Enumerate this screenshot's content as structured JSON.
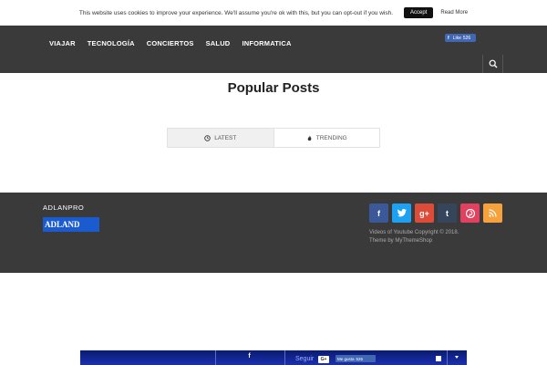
{
  "cookie": {
    "message": "This website uses cookies to improve your experience. We'll assume you're ok with this, but you can opt-out if you wish.",
    "accept_label": "Accept",
    "read_more_label": "Read More"
  },
  "nav": {
    "items": [
      "VIAJAR",
      "TECNOLOGÍA",
      "CONCIERTOS",
      "SALUD",
      "INFORMATICA"
    ]
  },
  "header": {
    "fb_like_label": "Like",
    "fb_like_count": "526"
  },
  "main": {
    "title": "Popular Posts",
    "tabs": [
      {
        "label": "LATEST",
        "icon": "clock-icon",
        "active": true
      },
      {
        "label": "TRENDING",
        "icon": "flame-icon",
        "active": false
      }
    ]
  },
  "footer": {
    "brand": "ADLANPRO",
    "logo_text": "ADLAND",
    "copyright": "Videos of Youtube Copyright © 2018.",
    "theme_credit": "Theme by MyThemeShop",
    "social": [
      {
        "name": "facebook",
        "glyph": "f",
        "color": "#3b5998"
      },
      {
        "name": "twitter",
        "glyph": "t",
        "color": "#1da1f2"
      },
      {
        "name": "google-plus",
        "glyph": "g+",
        "color": "#dd4b39"
      },
      {
        "name": "tumblr",
        "glyph": "t",
        "color": "#35465c"
      },
      {
        "name": "pinterest",
        "glyph": "p",
        "color": "#e1405f"
      },
      {
        "name": "rss",
        "glyph": "rss",
        "color": "#f7a13c"
      }
    ]
  },
  "bottom_bar": {
    "follow_label": "Seguir",
    "gplus_label": "G+",
    "like_label": "Me gusta",
    "like_count": "526"
  },
  "colors": {
    "header_bg": "#3a3a3a",
    "footer_bg": "#3a3a3a",
    "accent_blue": "#1b5bd0",
    "facebook_blue": "#4267b2"
  }
}
